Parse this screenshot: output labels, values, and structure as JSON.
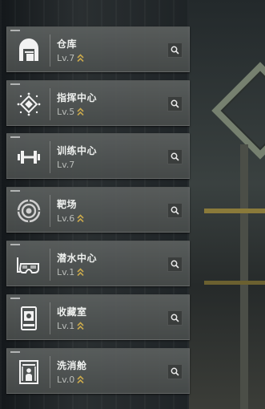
{
  "facilities": [
    {
      "name": "仓库",
      "level": "Lv.7",
      "upgradable": true,
      "icon": "warehouse-icon"
    },
    {
      "name": "指挥中心",
      "level": "Lv.5",
      "upgradable": true,
      "icon": "command-center-icon"
    },
    {
      "name": "训练中心",
      "level": "Lv.7",
      "upgradable": false,
      "icon": "dumbbell-icon"
    },
    {
      "name": "靶场",
      "level": "Lv.6",
      "upgradable": true,
      "icon": "target-icon"
    },
    {
      "name": "潜水中心",
      "level": "Lv.1",
      "upgradable": true,
      "icon": "diving-mask-icon"
    },
    {
      "name": "收藏室",
      "level": "Lv.1",
      "upgradable": true,
      "icon": "collection-case-icon"
    },
    {
      "name": "洗消舱",
      "level": "Lv.0",
      "upgradable": true,
      "icon": "decontamination-pod-icon"
    }
  ],
  "colors": {
    "upgrade_arrow": "#c9a84c",
    "text": "#eef0ee",
    "level_text": "#b9bcb9"
  }
}
